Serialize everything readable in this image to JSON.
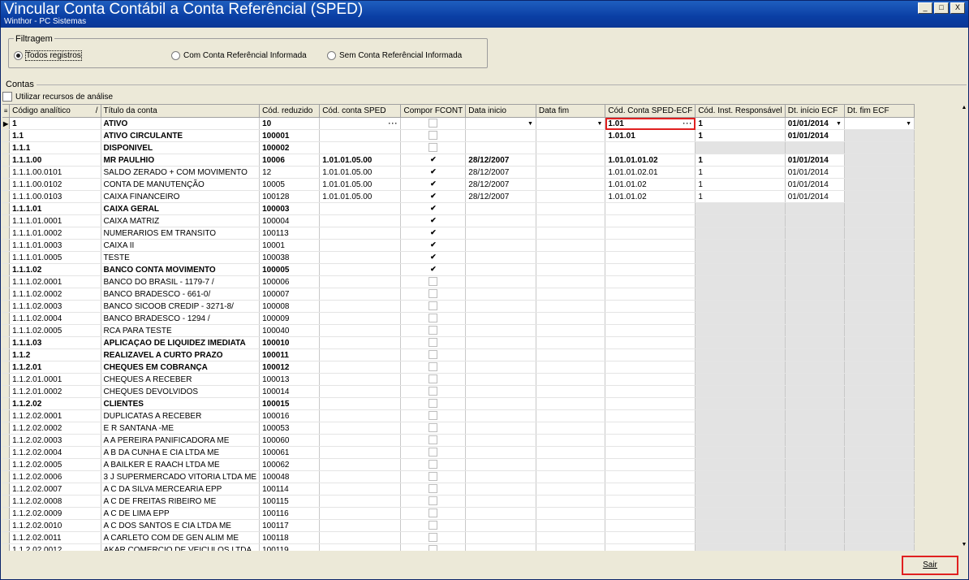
{
  "window": {
    "title": "Vincular Conta Contábil a Conta Referêncial (SPED)",
    "subtitle": "Winthor - PC Sistemas",
    "btn_min": "_",
    "btn_max": "□",
    "btn_close": "X"
  },
  "filter": {
    "label": "Filtragem",
    "options": [
      "Todos registros",
      "Com Conta Referêncial Informada",
      "Sem Conta Referêncial Informada"
    ],
    "selected_index": 0
  },
  "contas": {
    "label": "Contas",
    "analise_label": "Utilizar recursos de análise"
  },
  "grid": {
    "columns": [
      "Código analítico",
      "Título da conta",
      "Cód. reduzido",
      "Cód. conta SPED",
      "Compor FCONT",
      "Data inicio",
      "Data fim",
      "Cód. Conta SPED-ECF",
      "Cód. Inst. Responsável",
      "Dt. início ECF",
      "Dt. fim ECF"
    ],
    "sort_marker": "/",
    "rows": [
      {
        "bold": true,
        "code": "1",
        "title": "ATIVO",
        "reduced": "10",
        "sped": "",
        "fcont": "empty",
        "dini": "",
        "dfim": "",
        "ecf": "1.01",
        "inst": "1",
        "dtini": "01/01/2014",
        "dtfim": "",
        "edit": true
      },
      {
        "bold": true,
        "code": "1.1",
        "title": "ATIVO CIRCULANTE",
        "reduced": "100001",
        "sped": "",
        "fcont": "empty",
        "dini": "",
        "dfim": "",
        "ecf": "1.01.01",
        "inst": "1",
        "dtini": "01/01/2014",
        "dtfim": ""
      },
      {
        "bold": true,
        "code": "1.1.1",
        "title": "DISPONIVEL",
        "reduced": "100002",
        "sped": "",
        "fcont": "empty",
        "dini": "",
        "dfim": "",
        "ecf": "",
        "inst": "",
        "dtini": "",
        "dtfim": ""
      },
      {
        "bold": true,
        "code": "1.1.1.00",
        "title": "MR PAULHIO",
        "reduced": "10006",
        "sped": "1.01.01.05.00",
        "fcont": "on",
        "dini": "28/12/2007",
        "dfim": "",
        "ecf": "1.01.01.01.02",
        "inst": "1",
        "dtini": "01/01/2014",
        "dtfim": ""
      },
      {
        "bold": false,
        "code": "1.1.1.00.0101",
        "title": "SALDO ZERADO + COM MOVIMENTO",
        "reduced": "12",
        "sped": "1.01.01.05.00",
        "fcont": "on",
        "dini": "28/12/2007",
        "dfim": "",
        "ecf": "1.01.01.02.01",
        "inst": "1",
        "dtini": "01/01/2014",
        "dtfim": ""
      },
      {
        "bold": false,
        "code": "1.1.1.00.0102",
        "title": "CONTA DE MANUTENÇÃO",
        "reduced": "10005",
        "sped": "1.01.01.05.00",
        "fcont": "on",
        "dini": "28/12/2007",
        "dfim": "",
        "ecf": "1.01.01.02",
        "inst": "1",
        "dtini": "01/01/2014",
        "dtfim": ""
      },
      {
        "bold": false,
        "code": "1.1.1.00.0103",
        "title": "CAIXA FINANCEIRO",
        "reduced": "100128",
        "sped": "1.01.01.05.00",
        "fcont": "on",
        "dini": "28/12/2007",
        "dfim": "",
        "ecf": "1.01.01.02",
        "inst": "1",
        "dtini": "01/01/2014",
        "dtfim": ""
      },
      {
        "bold": true,
        "code": "1.1.1.01",
        "title": "CAIXA GERAL",
        "reduced": "100003",
        "sped": "",
        "fcont": "on",
        "dini": "",
        "dfim": "",
        "ecf": "",
        "inst": "",
        "dtini": "",
        "dtfim": ""
      },
      {
        "bold": false,
        "code": "1.1.1.01.0001",
        "title": "CAIXA MATRIZ",
        "reduced": "100004",
        "sped": "",
        "fcont": "on",
        "dini": "",
        "dfim": "",
        "ecf": "",
        "inst": "",
        "dtini": "",
        "dtfim": ""
      },
      {
        "bold": false,
        "code": "1.1.1.01.0002",
        "title": "NUMERARIOS EM TRANSITO",
        "reduced": "100113",
        "sped": "",
        "fcont": "on",
        "dini": "",
        "dfim": "",
        "ecf": "",
        "inst": "",
        "dtini": "",
        "dtfim": ""
      },
      {
        "bold": false,
        "code": "1.1.1.01.0003",
        "title": "CAIXA II",
        "reduced": "10001",
        "sped": "",
        "fcont": "on",
        "dini": "",
        "dfim": "",
        "ecf": "",
        "inst": "",
        "dtini": "",
        "dtfim": ""
      },
      {
        "bold": false,
        "code": "1.1.1.01.0005",
        "title": "TESTE",
        "reduced": "100038",
        "sped": "",
        "fcont": "on",
        "dini": "",
        "dfim": "",
        "ecf": "",
        "inst": "",
        "dtini": "",
        "dtfim": ""
      },
      {
        "bold": true,
        "code": "1.1.1.02",
        "title": "BANCO CONTA MOVIMENTO",
        "reduced": "100005",
        "sped": "",
        "fcont": "on",
        "dini": "",
        "dfim": "",
        "ecf": "",
        "inst": "",
        "dtini": "",
        "dtfim": ""
      },
      {
        "bold": false,
        "code": "1.1.1.02.0001",
        "title": "BANCO DO BRASIL - 1179-7 /",
        "reduced": "100006",
        "sped": "",
        "fcont": "empty",
        "dini": "",
        "dfim": "",
        "ecf": "",
        "inst": "",
        "dtini": "",
        "dtfim": ""
      },
      {
        "bold": false,
        "code": "1.1.1.02.0002",
        "title": "BANCO BRADESCO - 661-0/",
        "reduced": "100007",
        "sped": "",
        "fcont": "empty",
        "dini": "",
        "dfim": "",
        "ecf": "",
        "inst": "",
        "dtini": "",
        "dtfim": ""
      },
      {
        "bold": false,
        "code": "1.1.1.02.0003",
        "title": "BANCO SICOOB CREDIP - 3271-8/",
        "reduced": "100008",
        "sped": "",
        "fcont": "empty",
        "dini": "",
        "dfim": "",
        "ecf": "",
        "inst": "",
        "dtini": "",
        "dtfim": ""
      },
      {
        "bold": false,
        "code": "1.1.1.02.0004",
        "title": "BANCO BRADESCO - 1294 /",
        "reduced": "100009",
        "sped": "",
        "fcont": "empty",
        "dini": "",
        "dfim": "",
        "ecf": "",
        "inst": "",
        "dtini": "",
        "dtfim": ""
      },
      {
        "bold": false,
        "code": "1.1.1.02.0005",
        "title": "RCA PARA TESTE",
        "reduced": "100040",
        "sped": "",
        "fcont": "empty",
        "dini": "",
        "dfim": "",
        "ecf": "",
        "inst": "",
        "dtini": "",
        "dtfim": ""
      },
      {
        "bold": true,
        "code": "1.1.1.03",
        "title": "APLICAÇAO DE LIQUIDEZ IMEDIATA",
        "reduced": "100010",
        "sped": "",
        "fcont": "empty",
        "dini": "",
        "dfim": "",
        "ecf": "",
        "inst": "",
        "dtini": "",
        "dtfim": ""
      },
      {
        "bold": true,
        "code": "1.1.2",
        "title": "REALIZAVEL A CURTO PRAZO",
        "reduced": "100011",
        "sped": "",
        "fcont": "empty",
        "dini": "",
        "dfim": "",
        "ecf": "",
        "inst": "",
        "dtini": "",
        "dtfim": ""
      },
      {
        "bold": true,
        "code": "1.1.2.01",
        "title": "CHEQUES EM COBRANÇA",
        "reduced": "100012",
        "sped": "",
        "fcont": "empty",
        "dini": "",
        "dfim": "",
        "ecf": "",
        "inst": "",
        "dtini": "",
        "dtfim": ""
      },
      {
        "bold": false,
        "code": "1.1.2.01.0001",
        "title": "CHEQUES A RECEBER",
        "reduced": "100013",
        "sped": "",
        "fcont": "empty",
        "dini": "",
        "dfim": "",
        "ecf": "",
        "inst": "",
        "dtini": "",
        "dtfim": ""
      },
      {
        "bold": false,
        "code": "1.1.2.01.0002",
        "title": "CHEQUES DEVOLVIDOS",
        "reduced": "100014",
        "sped": "",
        "fcont": "empty",
        "dini": "",
        "dfim": "",
        "ecf": "",
        "inst": "",
        "dtini": "",
        "dtfim": ""
      },
      {
        "bold": true,
        "code": "1.1.2.02",
        "title": "CLIENTES",
        "reduced": "100015",
        "sped": "",
        "fcont": "empty",
        "dini": "",
        "dfim": "",
        "ecf": "",
        "inst": "",
        "dtini": "",
        "dtfim": ""
      },
      {
        "bold": false,
        "code": "1.1.2.02.0001",
        "title": "DUPLICATAS A RECEBER",
        "reduced": "100016",
        "sped": "",
        "fcont": "empty",
        "dini": "",
        "dfim": "",
        "ecf": "",
        "inst": "",
        "dtini": "",
        "dtfim": ""
      },
      {
        "bold": false,
        "code": "1.1.2.02.0002",
        "title": " E R SANTANA -ME",
        "reduced": "100053",
        "sped": "",
        "fcont": "empty",
        "dini": "",
        "dfim": "",
        "ecf": "",
        "inst": "",
        "dtini": "",
        "dtfim": ""
      },
      {
        "bold": false,
        "code": "1.1.2.02.0003",
        "title": "A A PEREIRA PANIFICADORA ME",
        "reduced": "100060",
        "sped": "",
        "fcont": "empty",
        "dini": "",
        "dfim": "",
        "ecf": "",
        "inst": "",
        "dtini": "",
        "dtfim": ""
      },
      {
        "bold": false,
        "code": "1.1.2.02.0004",
        "title": "A B DA CUNHA E CIA LTDA ME",
        "reduced": "100061",
        "sped": "",
        "fcont": "empty",
        "dini": "",
        "dfim": "",
        "ecf": "",
        "inst": "",
        "dtini": "",
        "dtfim": ""
      },
      {
        "bold": false,
        "code": "1.1.2.02.0005",
        "title": "A BAILKER E RAACH LTDA ME",
        "reduced": "100062",
        "sped": "",
        "fcont": "empty",
        "dini": "",
        "dfim": "",
        "ecf": "",
        "inst": "",
        "dtini": "",
        "dtfim": ""
      },
      {
        "bold": false,
        "code": "1.1.2.02.0006",
        "title": "3 J SUPERMERCADO VITORIA LTDA ME",
        "reduced": "100048",
        "sped": "",
        "fcont": "empty",
        "dini": "",
        "dfim": "",
        "ecf": "",
        "inst": "",
        "dtini": "",
        "dtfim": ""
      },
      {
        "bold": false,
        "code": "1.1.2.02.0007",
        "title": "A C DA SILVA MERCEARIA  EPP",
        "reduced": "100114",
        "sped": "",
        "fcont": "empty",
        "dini": "",
        "dfim": "",
        "ecf": "",
        "inst": "",
        "dtini": "",
        "dtfim": ""
      },
      {
        "bold": false,
        "code": "1.1.2.02.0008",
        "title": "A C DE FREITAS RIBEIRO ME",
        "reduced": "100115",
        "sped": "",
        "fcont": "empty",
        "dini": "",
        "dfim": "",
        "ecf": "",
        "inst": "",
        "dtini": "",
        "dtfim": ""
      },
      {
        "bold": false,
        "code": "1.1.2.02.0009",
        "title": "A C DE LIMA EPP",
        "reduced": "100116",
        "sped": "",
        "fcont": "empty",
        "dini": "",
        "dfim": "",
        "ecf": "",
        "inst": "",
        "dtini": "",
        "dtfim": ""
      },
      {
        "bold": false,
        "code": "1.1.2.02.0010",
        "title": "A C DOS SANTOS E CIA LTDA ME",
        "reduced": "100117",
        "sped": "",
        "fcont": "empty",
        "dini": "",
        "dfim": "",
        "ecf": "",
        "inst": "",
        "dtini": "",
        "dtfim": ""
      },
      {
        "bold": false,
        "code": "1.1.2.02.0011",
        "title": "A CARLETO COM DE GEN ALIM ME",
        "reduced": "100118",
        "sped": "",
        "fcont": "empty",
        "dini": "",
        "dfim": "",
        "ecf": "",
        "inst": "",
        "dtini": "",
        "dtfim": ""
      },
      {
        "bold": false,
        "code": "1.1.2.02.0012",
        "title": "AKAR COMERCIO DE VEICULOS LTDA",
        "reduced": "100119",
        "sped": "",
        "fcont": "empty",
        "dini": "",
        "dfim": "",
        "ecf": "",
        "inst": "",
        "dtini": "",
        "dtfim": ""
      }
    ]
  },
  "footer": {
    "sair_label": "Sair"
  },
  "colors": {
    "title_bar": "#0a3ea4",
    "highlight": "#e02020",
    "window_bg": "#ece9d8"
  }
}
